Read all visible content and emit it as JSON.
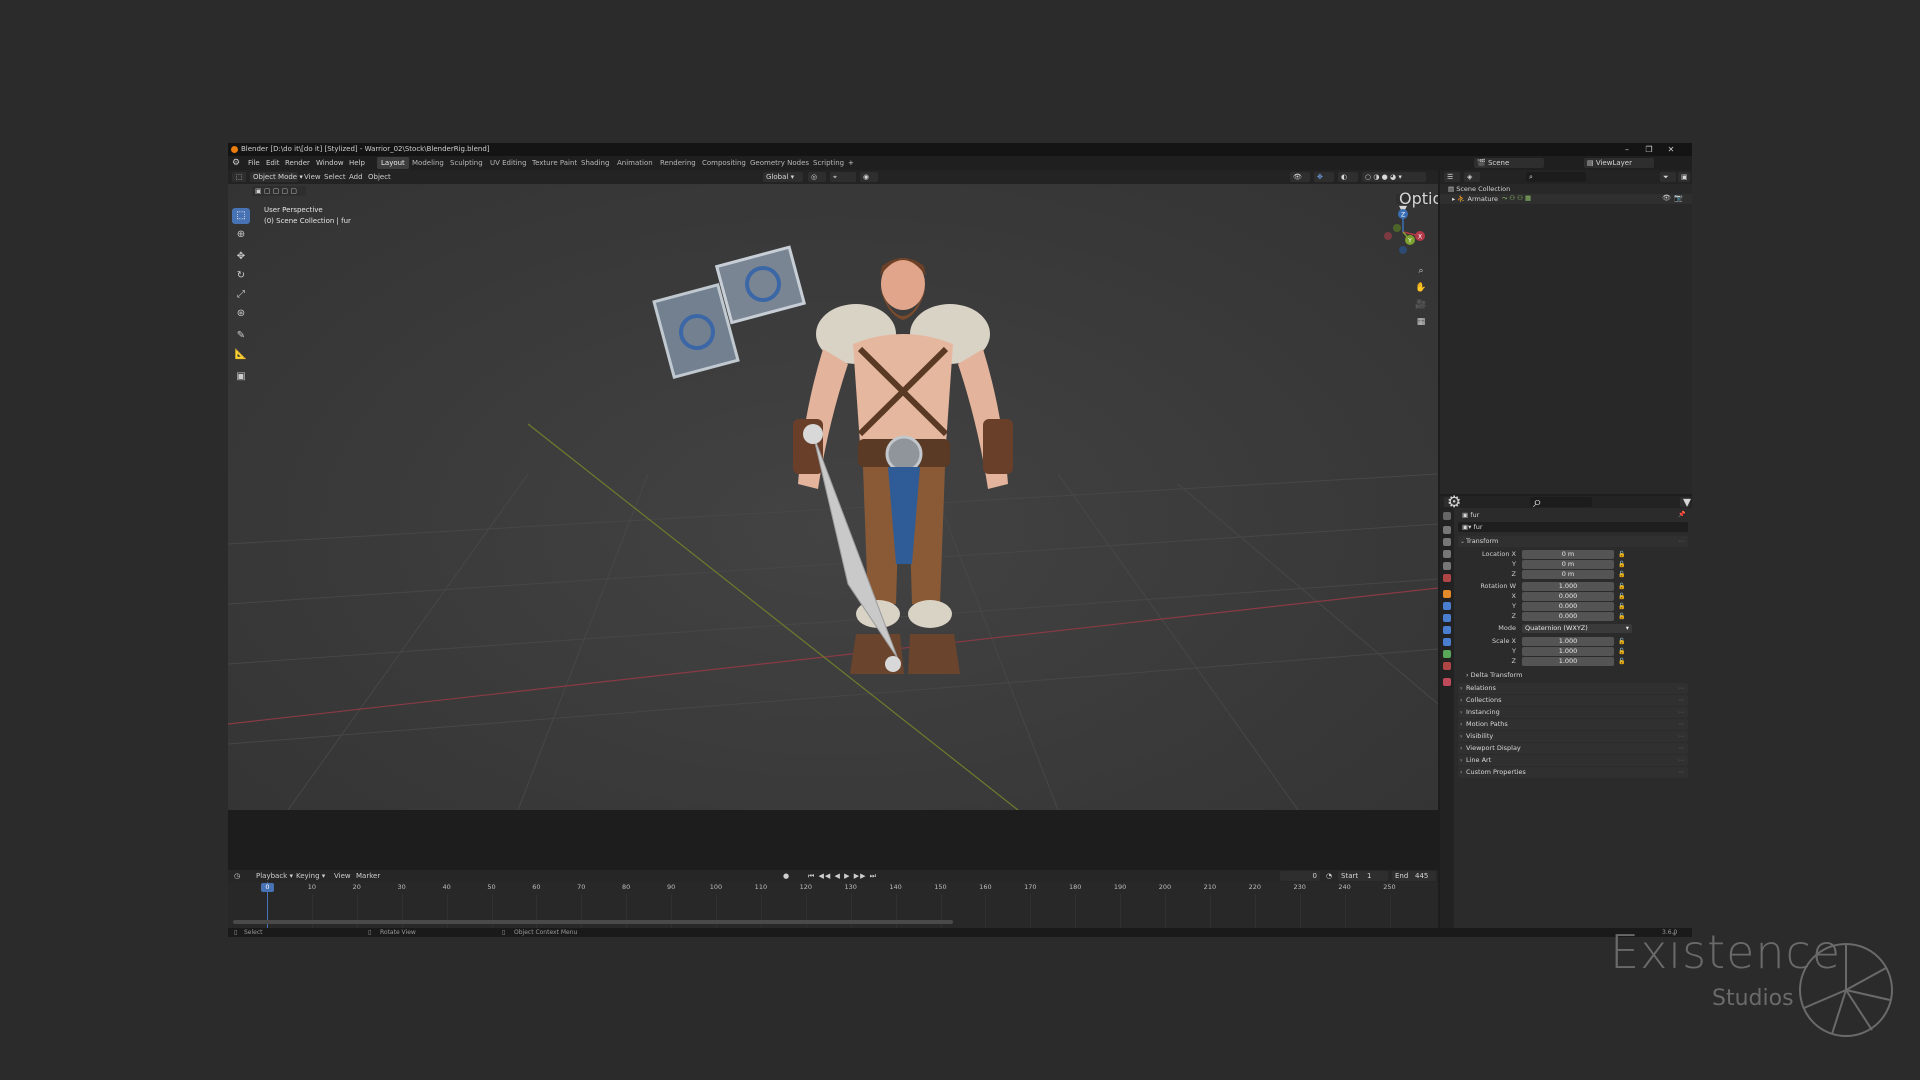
{
  "window": {
    "title": "Blender [D:\\do it\\[do it] [Stylized] - Warrior_02\\Stock\\BlenderRig.blend]",
    "controls": [
      "–",
      "❐",
      "✕"
    ]
  },
  "menubar": {
    "menus": [
      "File",
      "Edit",
      "Render",
      "Window",
      "Help"
    ],
    "workspaces": [
      "Layout",
      "Modeling",
      "Sculpting",
      "UV Editing",
      "Texture Paint",
      "Shading",
      "Animation",
      "Rendering",
      "Compositing",
      "Geometry Nodes",
      "Scripting"
    ],
    "active_workspace": "Layout",
    "add_tab": "+",
    "scene_label": "Scene",
    "view_layer_label": "ViewLayer"
  },
  "viewport": {
    "mode": "Object Mode",
    "menus": [
      "View",
      "Select",
      "Add",
      "Object"
    ],
    "transform_orientation": "Global",
    "options_label": "Options",
    "overlay_line1": "User Perspective",
    "overlay_line2": "(0) Scene Collection | fur",
    "gizmo": {
      "x": "X",
      "y": "Y",
      "z": "Z"
    },
    "tools": [
      "select-box",
      "cursor",
      "move",
      "rotate",
      "scale",
      "transform",
      "annotate",
      "measure",
      "add-cube"
    ]
  },
  "outliner": {
    "root": "Scene Collection",
    "items": [
      {
        "name": "Armature"
      }
    ]
  },
  "properties": {
    "object_name": "fur",
    "data_name": "fur",
    "transform_title": "Transform",
    "location_label": "Location X",
    "location": [
      "0 m",
      "0 m",
      "0 m"
    ],
    "rotation_label": "Rotation W",
    "rotation": [
      "1.000",
      "0.000",
      "0.000",
      "0.000"
    ],
    "mode_label": "Mode",
    "mode_value": "Quaternion (WXYZ)",
    "scale_label": "Scale X",
    "scale": [
      "1.000",
      "1.000",
      "1.000"
    ],
    "axis_labels": [
      "Y",
      "Z",
      "X",
      "Y",
      "Z"
    ],
    "delta_transform": "Delta Transform",
    "panels": [
      "Relations",
      "Collections",
      "Instancing",
      "Motion Paths",
      "Visibility",
      "Viewport Display",
      "Line Art",
      "Custom Properties"
    ]
  },
  "timeline": {
    "menus": [
      "Playback",
      "Keying",
      "View",
      "Marker"
    ],
    "current_frame": "0",
    "start_label": "Start",
    "start": "1",
    "end_label": "End",
    "end": "445",
    "ticks": [
      "0",
      "10",
      "20",
      "30",
      "40",
      "50",
      "60",
      "70",
      "80",
      "90",
      "100",
      "110",
      "120",
      "130",
      "140",
      "150",
      "160",
      "170",
      "180",
      "190",
      "200",
      "210",
      "220",
      "230",
      "240",
      "250"
    ]
  },
  "statusbar": {
    "items": [
      "Select",
      "Rotate View",
      "Object Context Menu"
    ],
    "version": "3.6.0"
  },
  "watermark": {
    "line1": "Existence",
    "line2": "Studios"
  },
  "colors": {
    "accent": "#4772b3",
    "active_frame": "#4772b3",
    "x_axis": "#b23a48",
    "y_axis": "#7da02e",
    "z_axis": "#3a6fb5"
  }
}
